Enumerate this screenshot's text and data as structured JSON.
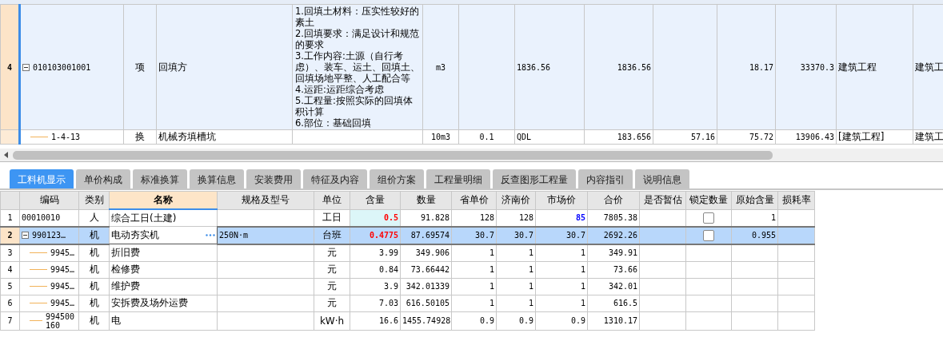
{
  "top_table": {
    "rows": [
      {
        "row_number": "4",
        "selected": true,
        "expanded": true,
        "code": "010103001001",
        "type": "项",
        "name": "回填方",
        "features": "1.回填土材料：压实性较好的素土\n2.回填要求：满足设计和规范的要求\n3.工作内容:土源（自行考虑）、装车、运土、回填土、回填场地平整、人工配合等\n4.运距:运距综合考虑\n5.工程量:按照实际的回填体积计算\n6.部位：基础回填",
        "unit": "m3",
        "column_8": "1836.56",
        "column_9": "1836.56",
        "column_11": "18.17",
        "column_12": "33370.3",
        "column_13": "建筑工程",
        "column_14": "建筑工",
        "children": [
          {
            "selected": false,
            "code": "1-4-13",
            "type": "换",
            "name": "机械夯填槽坑",
            "unit": "10m3",
            "column_7": "0.1",
            "column_8": "QDL",
            "column_9": "183.656",
            "column_10": "57.16",
            "column_11": "75.72",
            "column_12": "13906.43",
            "column_13": "[建筑工程]",
            "column_14": "建筑工"
          }
        ]
      }
    ]
  },
  "tabs": [
    {
      "label": "工料机显示",
      "selected": true
    },
    {
      "label": "单价构成",
      "selected": false
    },
    {
      "label": "标准换算",
      "selected": false
    },
    {
      "label": "换算信息",
      "selected": false
    },
    {
      "label": "安装费用",
      "selected": false
    },
    {
      "label": "特征及内容",
      "selected": false
    },
    {
      "label": "组价方案",
      "selected": false
    },
    {
      "label": "工程量明细",
      "selected": false
    },
    {
      "label": "反查图形工程量",
      "selected": false
    },
    {
      "label": "内容指引",
      "selected": false
    },
    {
      "label": "说明信息",
      "selected": false
    }
  ],
  "resource_table": {
    "columns": [
      {
        "label": "编码",
        "selected": false
      },
      {
        "label": "类别",
        "selected": false
      },
      {
        "label": "名称",
        "selected": true
      },
      {
        "label": "规格及型号",
        "selected": false
      },
      {
        "label": "单位",
        "selected": false
      },
      {
        "label": "含量",
        "selected": false
      },
      {
        "label": "数量",
        "selected": false
      },
      {
        "label": "省单价",
        "selected": false
      },
      {
        "label": "济南价",
        "selected": false
      },
      {
        "label": "市场价",
        "selected": false
      },
      {
        "label": "合价",
        "selected": false
      },
      {
        "label": "是否暂估",
        "selected": false
      },
      {
        "label": "锁定数量",
        "selected": false
      },
      {
        "label": "原始含量",
        "selected": false
      },
      {
        "label": "损耗率",
        "selected": false
      }
    ],
    "rows": [
      {
        "row_number": "1",
        "selected": false,
        "code": "00010010",
        "category": "人",
        "name": "综合工日(土建)",
        "unit": "工日",
        "quantity": "0.5",
        "quantity_modified": true,
        "amount": "91.828",
        "province_price": "128",
        "jinan_price": "128",
        "market_price": "85",
        "market_price_modified": true,
        "total": "7805.38",
        "locked": false,
        "original_quantity": "1"
      },
      {
        "row_number": "2",
        "selected": true,
        "expanded": true,
        "code": "990123…",
        "category": "机",
        "name": "电动夯实机",
        "spec": "250N·m",
        "unit": "台班",
        "quantity": "0.4775",
        "quantity_modified": true,
        "amount": "87.69574",
        "province_price": "30.7",
        "jinan_price": "30.7",
        "market_price": "30.7",
        "market_price_modified": false,
        "total": "2692.26",
        "locked": false,
        "original_quantity": "0.955",
        "children": [
          {
            "row_number": "3",
            "selected": false,
            "code": "9945…",
            "category": "机",
            "name": "折旧费",
            "unit": "元",
            "quantity": "3.99",
            "quantity_modified": false,
            "amount": "349.906",
            "province_price": "1",
            "jinan_price": "1",
            "market_price": "1",
            "market_price_modified": false,
            "total": "349.91"
          },
          {
            "row_number": "4",
            "selected": false,
            "code": "9945…",
            "category": "机",
            "name": "检修费",
            "unit": "元",
            "quantity": "0.84",
            "quantity_modified": false,
            "amount": "73.66442",
            "province_price": "1",
            "jinan_price": "1",
            "market_price": "1",
            "market_price_modified": false,
            "total": "73.66"
          },
          {
            "row_number": "5",
            "selected": false,
            "code": "9945…",
            "category": "机",
            "name": "维护费",
            "unit": "元",
            "quantity": "3.9",
            "quantity_modified": false,
            "amount": "342.01339",
            "province_price": "1",
            "jinan_price": "1",
            "market_price": "1",
            "market_price_modified": false,
            "total": "342.01"
          },
          {
            "row_number": "6",
            "selected": false,
            "code": "9945…",
            "category": "机",
            "name": "安拆费及场外运费",
            "unit": "元",
            "quantity": "7.03",
            "quantity_modified": false,
            "amount": "616.50105",
            "province_price": "1",
            "jinan_price": "1",
            "market_price": "1",
            "market_price_modified": false,
            "total": "616.5"
          },
          {
            "row_number": "7",
            "selected": false,
            "code": "994500160",
            "category": "机",
            "name": "电",
            "unit": "kW·h",
            "quantity": "16.6",
            "quantity_modified": false,
            "amount": "1455.74928",
            "province_price": "0.9",
            "jinan_price": "0.9",
            "market_price": "0.9",
            "market_price_modified": false,
            "total": "1310.17"
          }
        ]
      }
    ]
  }
}
